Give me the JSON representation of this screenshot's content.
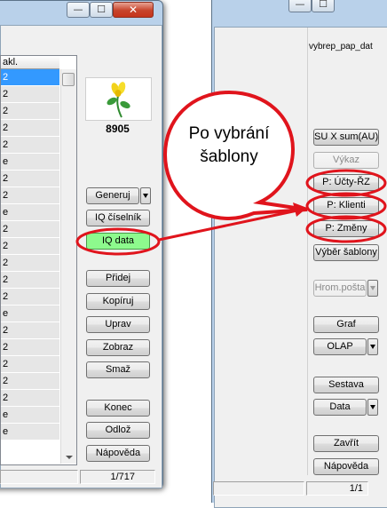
{
  "left": {
    "title_buttons": {
      "minimize": "—",
      "maximize": "☐",
      "close": "✕"
    },
    "grid": {
      "header": "akl.",
      "rows": [
        "2",
        "2",
        "2",
        "2",
        "2",
        "e",
        "2",
        "2",
        "e",
        "2",
        "2",
        "2",
        "2",
        "2",
        "e",
        "2",
        "2",
        "2",
        "2",
        "2",
        "e",
        "e"
      ]
    },
    "logo_number": "8905",
    "buttons": {
      "generuj": "Generuj",
      "iq_ciselnik": "IQ číselník",
      "iq_data": "IQ data",
      "pridej": "Přidej",
      "kopiruj": "Kopíruj",
      "uprav": "Uprav",
      "zobraz": "Zobraz",
      "smaz": "Smaž",
      "konec": "Konec",
      "odloz": "Odlož",
      "napoveda": "Nápověda"
    },
    "status": {
      "record": "1/717"
    }
  },
  "right": {
    "title_buttons": {
      "minimize": "—",
      "maximize": "☐"
    },
    "path": "vybrep_pap_dat",
    "buttons": {
      "su_x_sum": "SU X sum(AU)",
      "vykaz": "Výkaz",
      "ucty_rz": "P: Účty-ŘZ",
      "klienti": "P: Klienti",
      "zmeny": "P: Změny",
      "vyber_sablony": "Výběr šablony",
      "hrom_posta": "Hrom.pošta",
      "graf": "Graf",
      "olap": "OLAP",
      "sestava": "Sestava",
      "data": "Data",
      "zavrit": "Zavřít",
      "napoveda": "Nápověda"
    },
    "status": {
      "record": "1/1"
    }
  },
  "callout": {
    "text_line1": "Po vybrání",
    "text_line2": "šablony"
  },
  "colors": {
    "highlight_green": "#8dfa8d",
    "annotation_red": "#e0141c",
    "selection_blue": "#3399ff"
  }
}
